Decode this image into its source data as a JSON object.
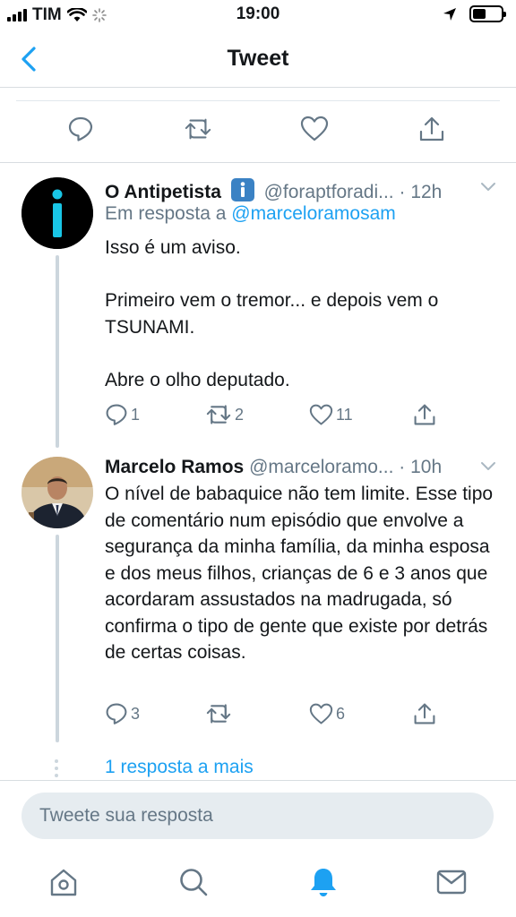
{
  "status_bar": {
    "carrier": "TIM",
    "time": "19:00"
  },
  "header": {
    "title": "Tweet"
  },
  "colors": {
    "accent": "#1da1f2",
    "text": "#14171a",
    "muted": "#657786",
    "thread_line": "#ccd6dd"
  },
  "replies": [
    {
      "name": "O Antipetista",
      "handle": "@foraptforadi...",
      "time": "· 12h",
      "reply_to_prefix": "Em resposta a",
      "reply_to_handle": "@marceloramosam",
      "text": "Isso é um aviso.\n\nPrimeiro vem o tremor... e depois vem o TSUNAMI.\n\nAbre o olho deputado.",
      "reply_count": "1",
      "retweet_count": "2",
      "like_count": "11"
    },
    {
      "name": "Marcelo Ramos",
      "handle": "@marceloramo...",
      "time": "· 10h",
      "text": "O nível de babaquice não tem limite. Esse tipo de comentário num episódio que envolve a segurança da minha família, da minha esposa e dos meus filhos, crianças de 6 e 3 anos que acordaram assustados na madrugada, só confirma o tipo de gente que existe por detrás de certas coisas.",
      "reply_count": "3",
      "retweet_count": "",
      "like_count": "6"
    }
  ],
  "more_replies": "1 resposta a mais",
  "composer": {
    "placeholder": "Tweete sua resposta"
  },
  "tabs": [
    "home-icon",
    "search-icon",
    "notifications-icon",
    "messages-icon"
  ]
}
